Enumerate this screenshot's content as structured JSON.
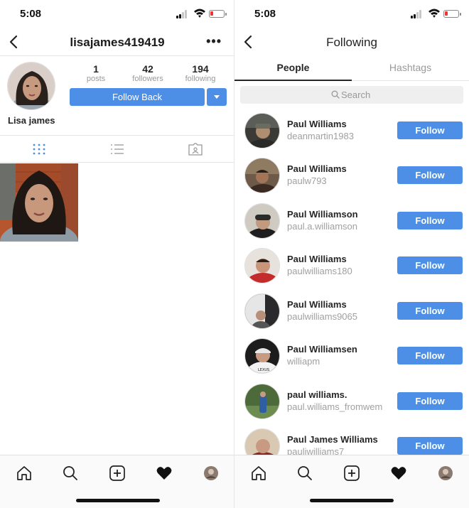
{
  "status_time": "5:08",
  "left": {
    "nav": {
      "title": "lisajames419419",
      "more_label": "•••"
    },
    "profile": {
      "display_name": "Lisa james",
      "stats": [
        {
          "value": "1",
          "label": "posts"
        },
        {
          "value": "42",
          "label": "followers"
        },
        {
          "value": "194",
          "label": "following"
        }
      ],
      "follow_back_label": "Follow Back"
    }
  },
  "right": {
    "nav": {
      "title": "Following"
    },
    "tabs": [
      "People",
      "Hashtags"
    ],
    "search_placeholder": "Search",
    "follow_label": "Follow",
    "people": [
      {
        "name": "Paul Williams",
        "username": "deanmartin1983"
      },
      {
        "name": "Paul Williams",
        "username": "paulw793"
      },
      {
        "name": "Paul Williamson",
        "username": "paul.a.williamson"
      },
      {
        "name": "Paul Williams",
        "username": "paulwilliams180"
      },
      {
        "name": "Paul Williams",
        "username": "paulwilliams9065"
      },
      {
        "name": "Paul Williamsen",
        "username": "williapm"
      },
      {
        "name": "paul  williams.",
        "username": "paul.williams_fromwem"
      },
      {
        "name": "Paul James Williams",
        "username": "pauliwilliams7"
      }
    ]
  },
  "tabbar_icons": [
    "home-icon",
    "search-icon",
    "add-post-icon",
    "heart-icon",
    "profile-avatar"
  ],
  "colors": {
    "accent": "#4d8fe6",
    "secondary_text": "#999999"
  }
}
